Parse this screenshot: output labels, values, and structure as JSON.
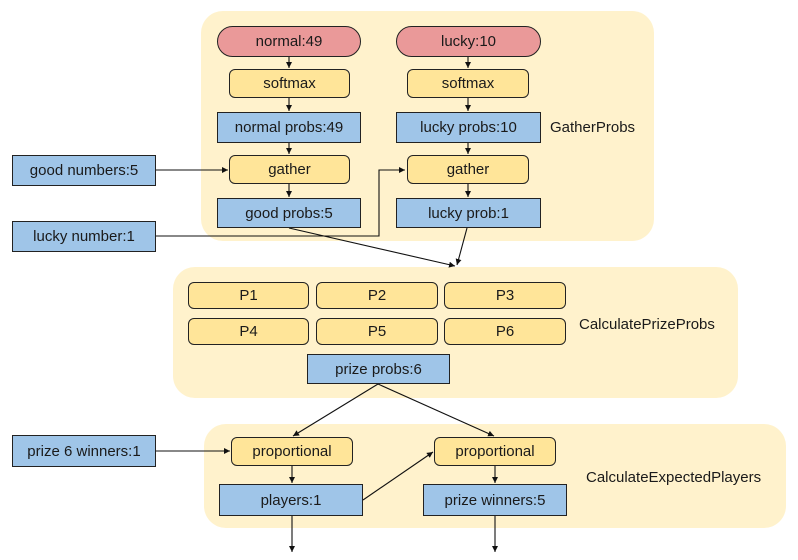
{
  "groups": {
    "gather_probs": "GatherProbs",
    "calculate_prize_probs": "CalculatePrizeProbs",
    "calculate_expected_players": "CalculateExpectedPlayers"
  },
  "nodes": {
    "normal": "normal:49",
    "lucky": "lucky:10",
    "softmax_normal": "softmax",
    "softmax_lucky": "softmax",
    "normal_probs": "normal probs:49",
    "lucky_probs": "lucky probs:10",
    "gather_good": "gather",
    "gather_lucky": "gather",
    "good_probs": "good probs:5",
    "lucky_prob": "lucky prob:1",
    "good_numbers": "good numbers:5",
    "lucky_number": "lucky number:1",
    "p1": "P1",
    "p2": "P2",
    "p3": "P3",
    "p4": "P4",
    "p5": "P5",
    "p6": "P6",
    "prize_probs": "prize probs:6",
    "prize6_winners": "prize 6 winners:1",
    "proportional_players": "proportional",
    "proportional_winners": "proportional",
    "players": "players:1",
    "prize_winners": "prize winners:5"
  },
  "colors": {
    "group_bg": "#fff2cc",
    "tensor": "#9fc5e8",
    "op": "#ffe599",
    "input": "#ea9999"
  }
}
